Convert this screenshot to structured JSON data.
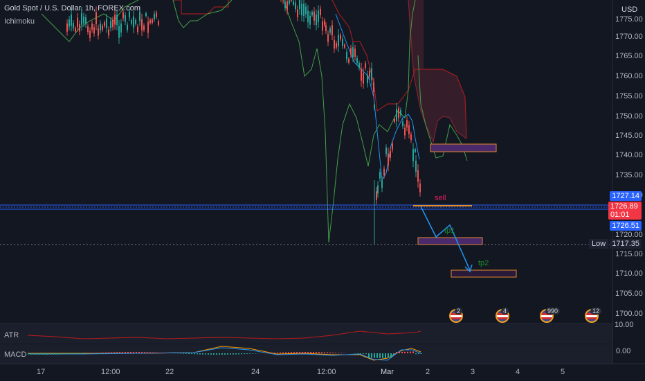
{
  "header": {
    "symbol": "Gold Spot / U.S. Dollar, 1h, FOREX.com",
    "indicator": "Ichimoku"
  },
  "currency": "USD",
  "price_axis": {
    "ticks": [
      "1775.00",
      "1770.00",
      "1765.00",
      "1760.00",
      "1755.00",
      "1750.00",
      "1745.00",
      "1740.00",
      "1735.00",
      "1730.00",
      "1720.00",
      "1715.00",
      "1710.00",
      "1705.00",
      "1700.00"
    ],
    "tags": {
      "blue_top": "1727.14",
      "current": "1726.89",
      "countdown": "01:01",
      "blue_bottom": "1726.51",
      "low_label": "Low",
      "low_value": "1717.35"
    }
  },
  "annotations": {
    "sell": "sell",
    "tp1": "tp1",
    "tp2": "tp2"
  },
  "events": [
    "2",
    "4",
    "990",
    "12"
  ],
  "panes": {
    "atr_label": "ATR",
    "atr_value": "10.00",
    "macd_label": "MACD",
    "macd_value": "0.00"
  },
  "time_axis": [
    "17",
    "12:00",
    "22",
    "24",
    "12:00",
    "Mar",
    "2",
    "3",
    "4",
    "5"
  ],
  "colors": {
    "background": "#131722",
    "candle_up": "#26a69a",
    "candle_down": "#ef5350",
    "tenkan": "#2196f3",
    "kijun": "#b71c1c",
    "chikou": "#43a047",
    "cloud": "#b03a48",
    "zone_fill": "#4a2a6a",
    "zone_border": "#e08a2a",
    "arrow": "#2196f3",
    "sell_text": "#e91e63",
    "tp_text": "#1b8a2a"
  }
}
